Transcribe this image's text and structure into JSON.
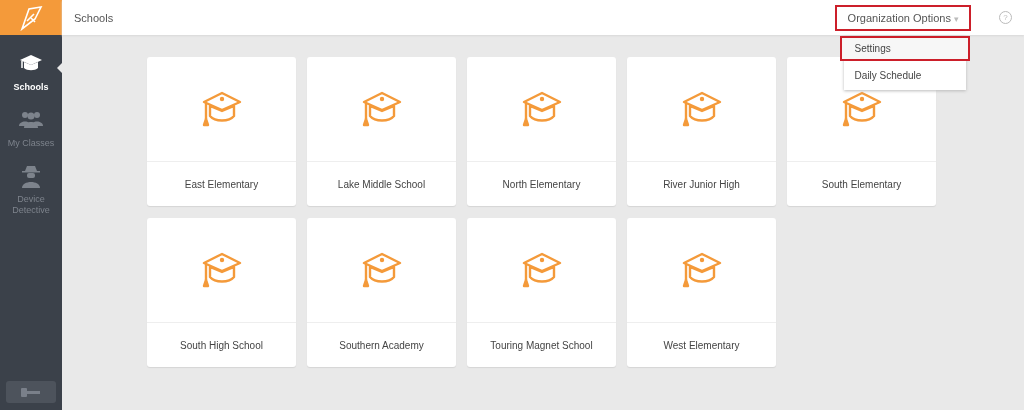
{
  "header": {
    "title": "Schools",
    "menu": {
      "label": "Organization Options",
      "caret": "▾",
      "highlighted": true,
      "expanded": true,
      "items": [
        {
          "label": "Settings",
          "highlighted": true
        },
        {
          "label": "Daily Schedule",
          "highlighted": false
        }
      ]
    },
    "help": "?"
  },
  "sidebar": {
    "items": [
      {
        "label": "Schools",
        "kind": "cap",
        "selected": true
      },
      {
        "label": "My Classes",
        "kind": "group",
        "selected": false
      },
      {
        "label": "Device Detective",
        "kind": "spy",
        "selected": false
      }
    ]
  },
  "schools": [
    {
      "name": "East Elementary"
    },
    {
      "name": "Lake Middle School"
    },
    {
      "name": "North Elementary"
    },
    {
      "name": "River Junior High"
    },
    {
      "name": "South Elementary"
    },
    {
      "name": "South High School"
    },
    {
      "name": "Southern Academy"
    },
    {
      "name": "Touring Magnet School"
    },
    {
      "name": "West Elementary"
    }
  ]
}
